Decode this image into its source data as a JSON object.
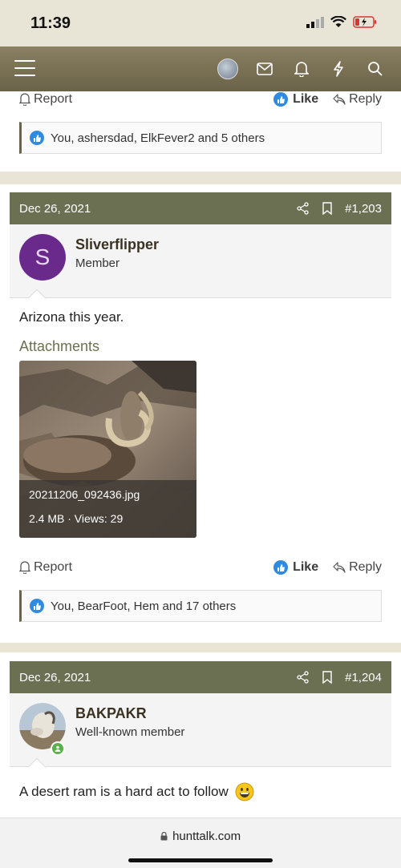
{
  "status": {
    "time": "11:39"
  },
  "browser": {
    "url": "hunttalk.com"
  },
  "colors": {
    "accent": "#6b7052",
    "like_blue": "#2f8ae0"
  },
  "posts": [
    {
      "actions": {
        "report": "Report",
        "like": "Like",
        "reply": "Reply"
      },
      "reactions": "You, ashersdad, ElkFever2 and 5 others"
    },
    {
      "date": "Dec 26, 2021",
      "number": "#1,203",
      "user": {
        "name": "Sliverflipper",
        "title": "Member",
        "avatar_letter": "S",
        "avatar_color": "#6a2a8c"
      },
      "body": "Arizona this year.",
      "attachments_label": "Attachments",
      "attachment": {
        "filename": "20211206_092436.jpg",
        "meta": "2.4 MB · Views: 29"
      },
      "actions": {
        "report": "Report",
        "like": "Like",
        "reply": "Reply"
      },
      "reactions": "You, BearFoot, Hem and 17 others"
    },
    {
      "date": "Dec 26, 2021",
      "number": "#1,204",
      "user": {
        "name": "BAKPAKR",
        "title": "Well-known member"
      },
      "body": "A desert ram is a hard act to follow"
    }
  ]
}
